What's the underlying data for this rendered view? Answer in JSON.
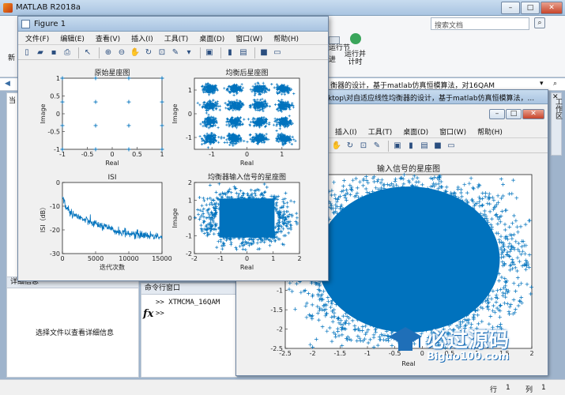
{
  "matlab": {
    "title": "MATLAB R2018a",
    "search_placeholder": "搜索文档",
    "ribbon_run_section": "运行节",
    "ribbon_advance": "进",
    "ribbon_run_time": "运行并\n计时",
    "ribbon_new": "新",
    "left_panel_top": "当",
    "address_text": "衡器的设计，基于matlab仿真恒模算法，对16QAM",
    "details_header": "详细信息",
    "details_text": "选择文件以查看详细信息",
    "command_title": "命令行窗口",
    "command_lines": [
      ">> XTMCMA_16QAM",
      ">>"
    ],
    "fx": "fx",
    "workspace_tab": "工作区",
    "status_row": "行",
    "status_row_val": "1",
    "status_col": "列",
    "status_col_val": "1"
  },
  "figure1": {
    "title": "Figure 1",
    "menu": [
      "文件(F)",
      "编辑(E)",
      "查看(V)",
      "插入(I)",
      "工具(T)",
      "桌面(D)",
      "窗口(W)",
      "帮助(H)"
    ]
  },
  "figure2": {
    "path_text": "ktop\\对自适应线性均衡器的设计，基于matlab仿真恒模算法，...",
    "menu": [
      "插入(I)",
      "工具(T)",
      "桌面(D)",
      "窗口(W)",
      "帮助(H)"
    ]
  },
  "watermark": {
    "line1": "必过源码",
    "line2": "Biguo100.com"
  },
  "colors": {
    "series": "#0072bd",
    "axes_bg": "#ffffff",
    "figure_bg": "#f0f0f0"
  },
  "chart_data": [
    {
      "type": "scatter",
      "title": "原始星座图",
      "xlabel": "Real",
      "ylabel": "Image",
      "xlim": [
        -1,
        1
      ],
      "ylim": [
        -1,
        1
      ],
      "xticks": [
        "-1",
        "-0.5",
        "0",
        "0.5",
        "1"
      ],
      "yticks": [
        "1",
        "0.5",
        "0",
        "-0.5",
        "-1"
      ],
      "x": [
        -1,
        -0.333,
        0.333,
        1,
        -1,
        -0.333,
        0.333,
        1,
        -1,
        -0.333,
        0.333,
        1,
        -1,
        -0.333,
        0.333,
        1
      ],
      "y": [
        1,
        1,
        1,
        1,
        0.333,
        0.333,
        0.333,
        0.333,
        -0.333,
        -0.333,
        -0.333,
        -0.333,
        -1,
        -1,
        -1,
        -1
      ],
      "marker": "+"
    },
    {
      "type": "scatter",
      "title": "均衡后星座图",
      "xlabel": "Real",
      "ylabel": "Image",
      "xlim": [
        -1.5,
        1.5
      ],
      "ylim": [
        -1.5,
        1.5
      ],
      "xticks": [
        "-1",
        "0",
        "1"
      ],
      "yticks": [
        "1",
        "0",
        "-1"
      ],
      "clusters_x": [
        -1.05,
        -0.35,
        0.35,
        1.05
      ],
      "clusters_y": [
        1.05,
        0.35,
        -0.35,
        -1.05
      ],
      "cluster_spread": 0.17,
      "marker": "+"
    },
    {
      "type": "line",
      "title": "ISI",
      "xlabel": "迭代次数",
      "ylabel": "ISI（dB）",
      "xlim": [
        0,
        15000
      ],
      "ylim": [
        -30,
        0
      ],
      "xticks": [
        "0",
        "5000",
        "10000",
        "15000"
      ],
      "yticks": [
        "0",
        "-10",
        "-20",
        "-30"
      ],
      "x": [
        0,
        500,
        1000,
        2000,
        3000,
        4000,
        5000,
        6000,
        7000,
        8000,
        9000,
        10000,
        11000,
        12000,
        13000,
        14000,
        15000
      ],
      "y": [
        -6,
        -10,
        -12,
        -14,
        -15.5,
        -16.5,
        -17.5,
        -18.5,
        -19.5,
        -20.5,
        -21,
        -21.5,
        -22,
        -22,
        -22.5,
        -22.5,
        -23
      ]
    },
    {
      "type": "scatter",
      "title": "均衡器输入信号的星座图",
      "xlabel": "Real",
      "ylabel": "Image",
      "xlim": [
        -2,
        2
      ],
      "ylim": [
        -2,
        2
      ],
      "xticks": [
        "-2",
        "-1",
        "0",
        "1",
        "2"
      ],
      "yticks": [
        "2",
        "1",
        "0",
        "-1",
        "-2"
      ],
      "marker": "+"
    },
    {
      "type": "scatter",
      "title": "输入信号的星座图",
      "xlabel": "Real",
      "ylabel": "",
      "xlim": [
        -2.5,
        2
      ],
      "ylim": [
        -2.5,
        2
      ],
      "xticks": [
        "-2.5",
        "-2",
        "-1.5",
        "-1",
        "-0.5",
        "0",
        "0.5",
        "1",
        "1.5",
        "2"
      ],
      "yticks": [
        "-1",
        "-1.5",
        "-2",
        "-2.5"
      ],
      "marker": "+"
    }
  ]
}
